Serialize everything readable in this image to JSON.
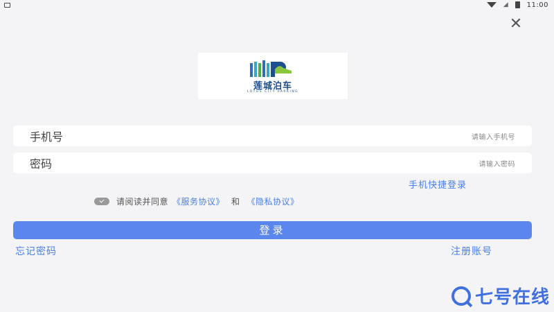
{
  "status_bar": {
    "time": "11:00",
    "icons": [
      "image-icon",
      "wifi-icon",
      "signal-icon",
      "battery-icon"
    ]
  },
  "close_icon": "close-icon",
  "logo": {
    "title": "莲城泊车",
    "subtitle": "LOTUS CITY PARKING",
    "colors": [
      "#2f6db8",
      "#3aa7c9",
      "#4cae4f",
      "#8cc63f",
      "#1d4f8f"
    ]
  },
  "form": {
    "phone": {
      "label": "手机号",
      "placeholder": "请输入手机号"
    },
    "password": {
      "label": "密码",
      "placeholder": "请输入密码"
    },
    "quick_login": "手机快捷登录"
  },
  "agreement": {
    "prefix": "请阅读并同意",
    "service": "《服务协议》",
    "and": "和",
    "privacy": "《隐私协议》",
    "checked": true
  },
  "login_button": "登录",
  "forgot_password": "忘记密码",
  "register": "注册账号",
  "watermark": "七号在线",
  "colors": {
    "accent": "#5b86ee",
    "link": "#4a7fe8",
    "background": "#f4f4f6"
  }
}
